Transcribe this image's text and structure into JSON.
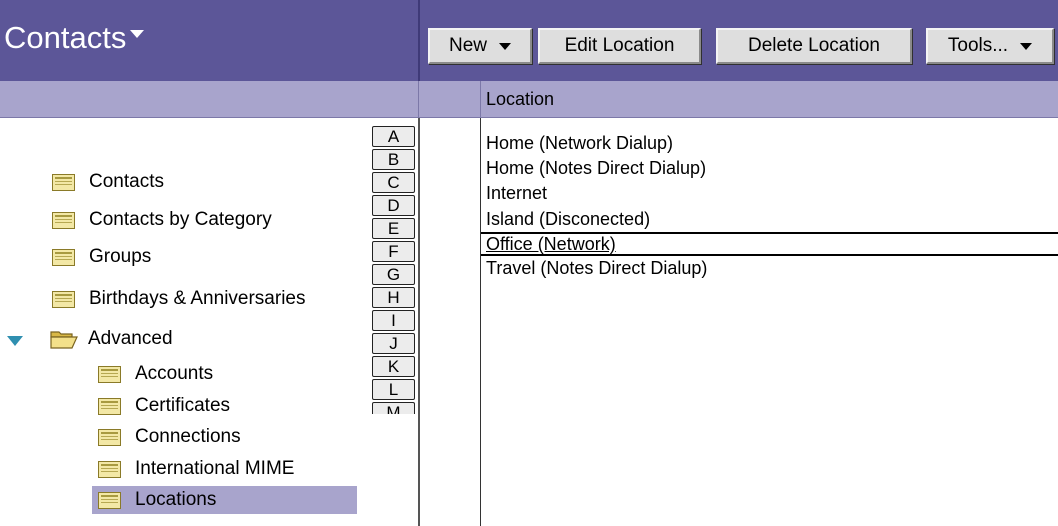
{
  "app": {
    "title": "Contacts"
  },
  "toolbar": {
    "new_label": "New",
    "edit_label": "Edit Location",
    "delete_label": "Delete Location",
    "tools_label": "Tools..."
  },
  "view": {
    "column_header": "Location"
  },
  "nav": {
    "items": [
      {
        "label": "Contacts"
      },
      {
        "label": "Contacts by Category"
      },
      {
        "label": "Groups"
      },
      {
        "label": "Birthdays & Anniversaries"
      },
      {
        "label": "Advanced"
      },
      {
        "label": "Accounts"
      },
      {
        "label": "Certificates"
      },
      {
        "label": "Connections"
      },
      {
        "label": "International MIME"
      },
      {
        "label": "Locations"
      }
    ],
    "selected": "Locations"
  },
  "alphabet": [
    "A",
    "B",
    "C",
    "D",
    "E",
    "F",
    "G",
    "H",
    "I",
    "J",
    "K",
    "L",
    "M"
  ],
  "rows": [
    {
      "location": "Home (Network Dialup)"
    },
    {
      "location": "Home (Notes Direct Dialup)"
    },
    {
      "location": "Internet"
    },
    {
      "location": "Island (Disconected)"
    },
    {
      "location": "Office (Network)"
    },
    {
      "location": "Travel (Notes Direct Dialup)"
    }
  ],
  "selected_row": "Office (Network)",
  "colors": {
    "title_bar": "#5c5698",
    "header_bar": "#a8a4cc",
    "selection": "#a8a4cc",
    "twisty": "#2f8fb0"
  },
  "icons": {
    "view": "view-icon",
    "folder": "open-folder-icon",
    "twisty": "expand-triangle-icon",
    "dropdown": "chevron-down-icon"
  }
}
